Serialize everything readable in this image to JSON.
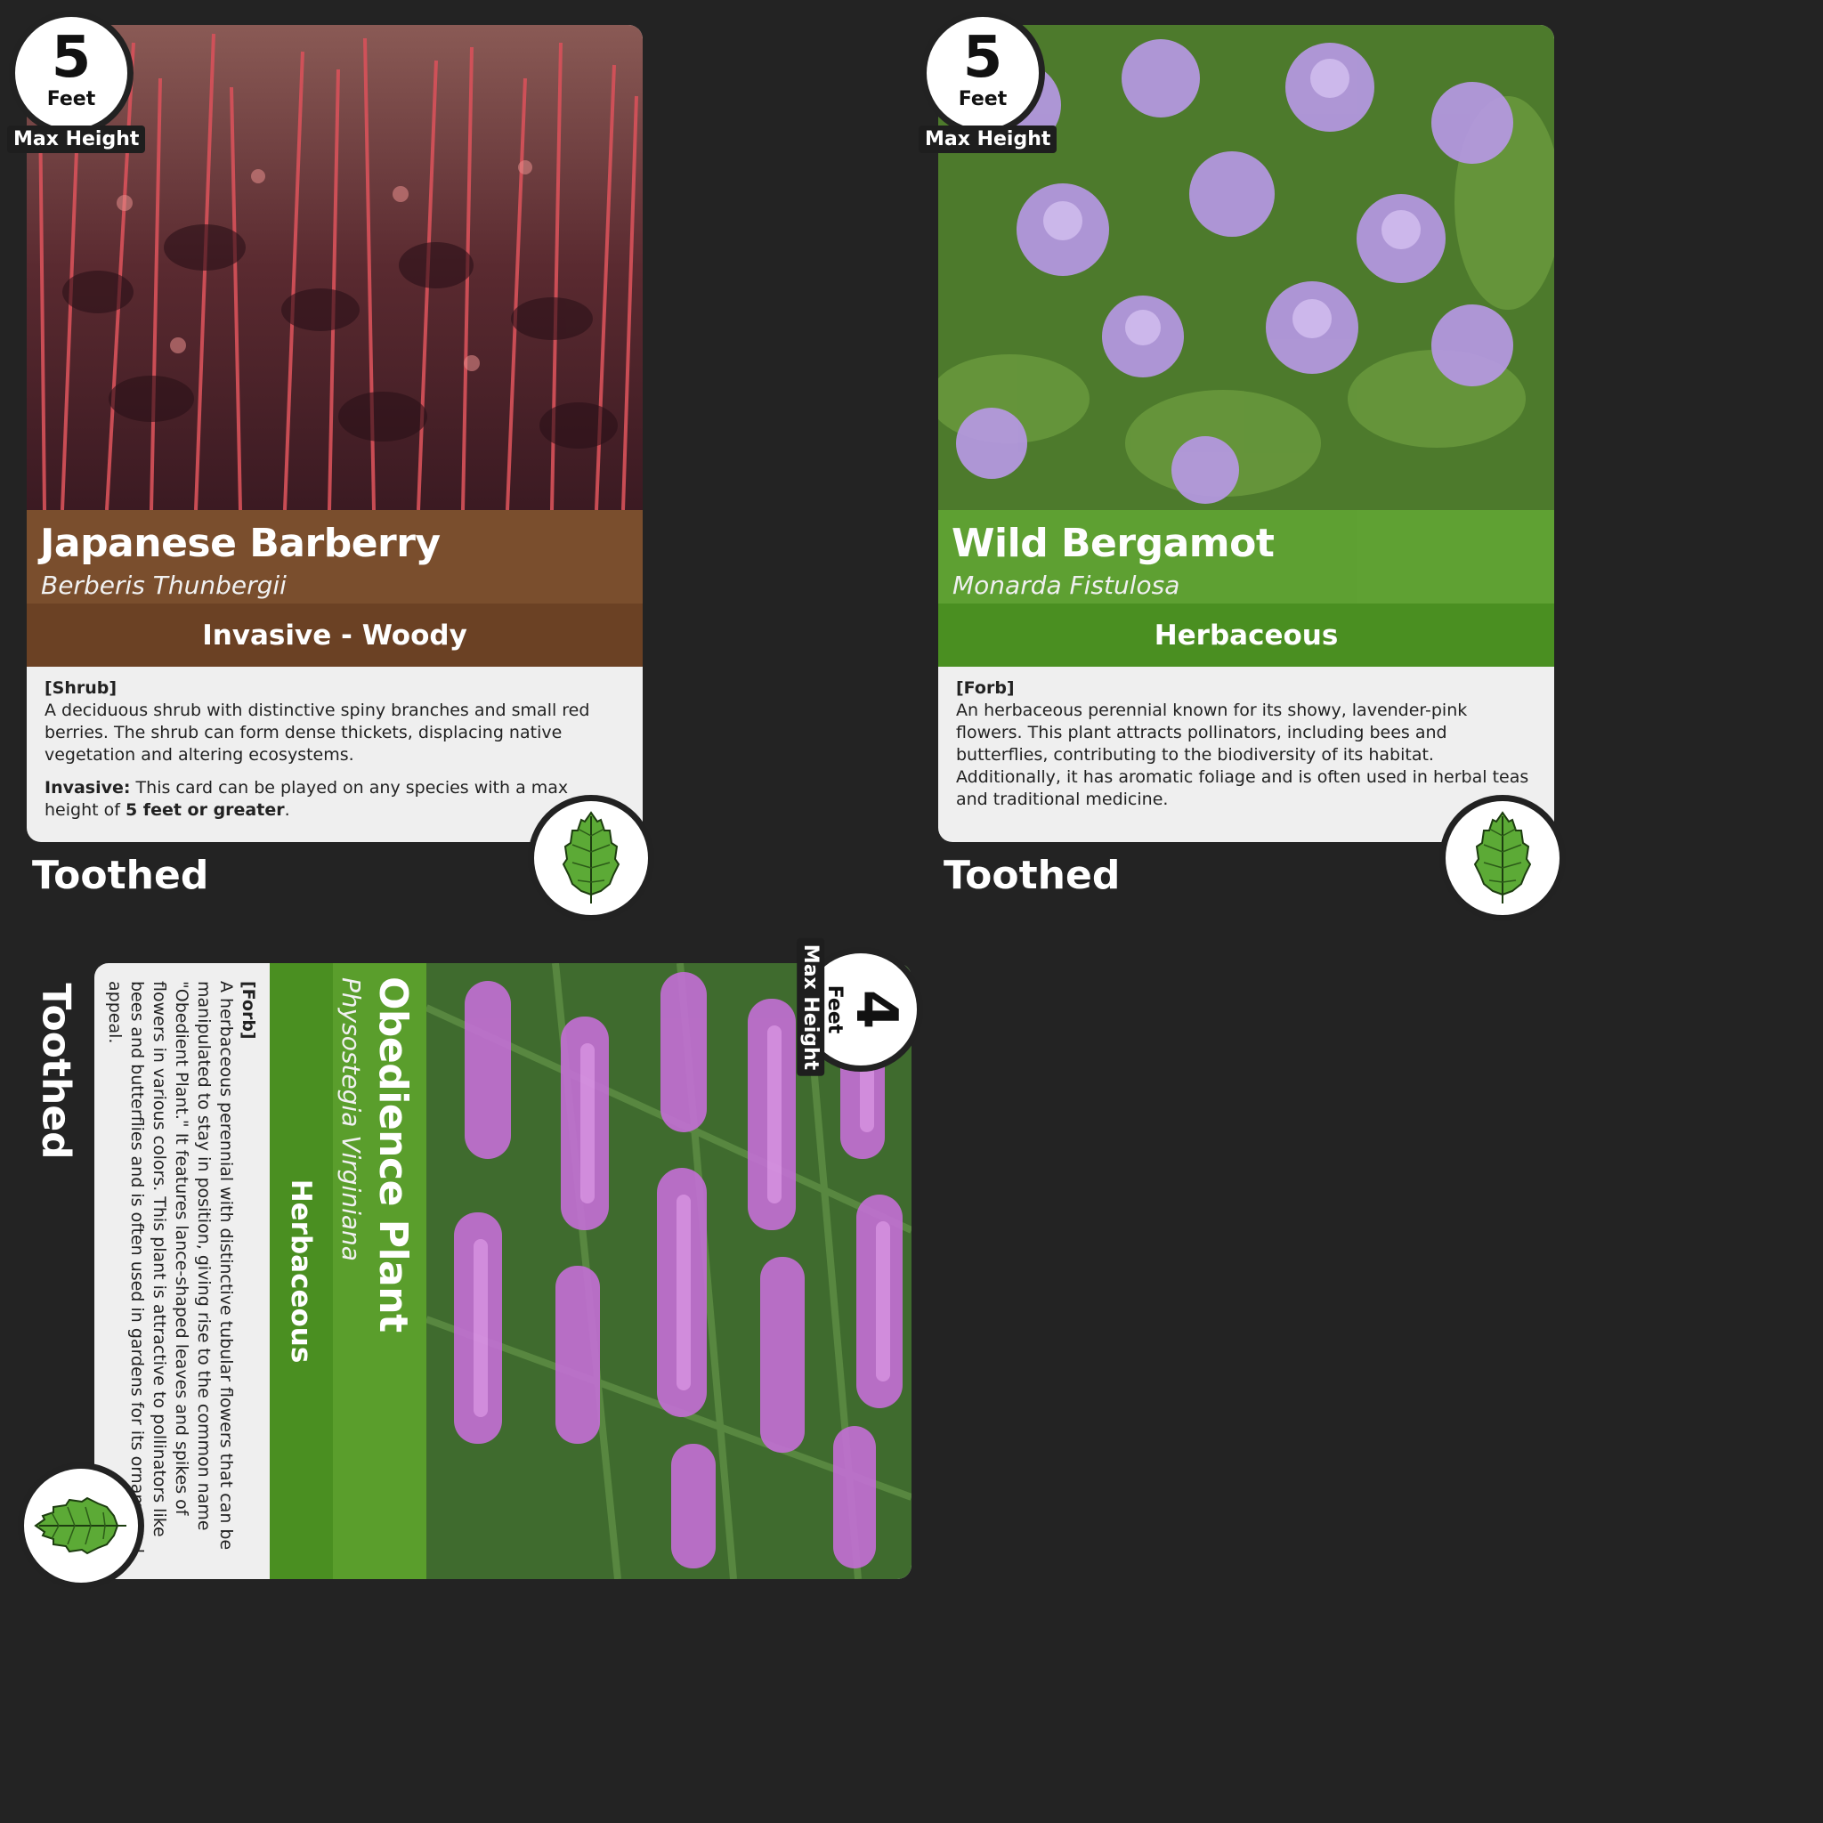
{
  "cards": [
    {
      "common_name": "Japanese Barberry",
      "latin_name": "Berberis Thunbergii",
      "type": "Invasive - Woody",
      "category": "[Shrub]",
      "description": "A deciduous shrub with distinctive spiny branches and small red berries. The shrub can form dense thickets, displacing native vegetation and altering ecosystems.",
      "rule_label": "Invasive:",
      "rule_text": "This card can be played on any species with a max height of",
      "rule_emphasis": "5 feet or greater",
      "rule_end": ".",
      "height_value": "5",
      "height_unit": "Feet",
      "height_tag": "Max Height",
      "leaf_label": "Toothed",
      "band_color": "#7a4e2d"
    },
    {
      "common_name": "Wild Bergamot",
      "latin_name": "Monarda Fistulosa",
      "type": "Herbaceous",
      "category": "[Forb]",
      "description": "An herbaceous perennial known for its showy, lavender-pink flowers. This plant attracts pollinators, including bees and butterflies, contributing to the biodiversity of its habitat. Additionally, it has aromatic foliage and is often used in herbal teas and traditional medicine.",
      "height_value": "5",
      "height_unit": "Feet",
      "height_tag": "Max Height",
      "leaf_label": "Toothed",
      "band_color": "#4a8f21"
    },
    {
      "common_name": "Obedience Plant",
      "latin_name": "Physostegia Virginiana",
      "type": "Herbaceous",
      "category": "[Forb]",
      "description": "A herbaceous perennial with distinctive tubular flowers that can be manipulated to stay in position, giving rise to the common name \"Obedient Plant.\" It features lance-shaped leaves and spikes of flowers in various colors. This plant is attractive to pollinators like bees and butterflies and is often used in gardens for its ornamental appeal.",
      "height_value": "4",
      "height_unit": "Feet",
      "height_tag": "Max Height",
      "leaf_label": "Toothed",
      "band_color": "#4a8f21"
    }
  ],
  "icons": {
    "leaf": "toothed-leaf-icon",
    "photo": "plant-photo"
  }
}
